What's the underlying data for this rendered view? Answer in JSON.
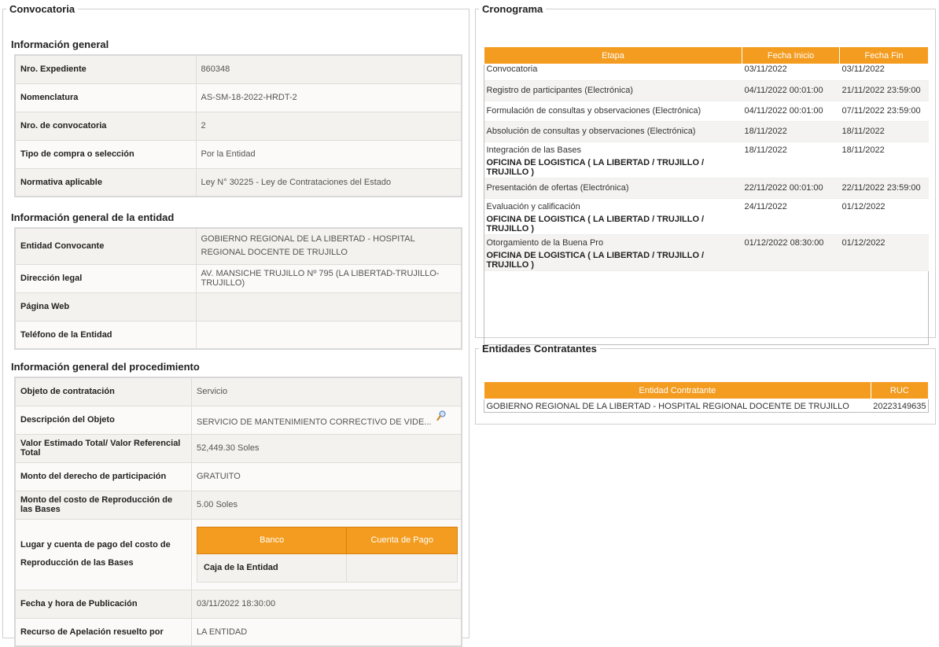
{
  "convocatoria": {
    "legend": "Convocatoria",
    "info_general": {
      "title": "Información general",
      "rows": [
        {
          "label": "Nro. Expediente",
          "value": "860348"
        },
        {
          "label": "Nomenclatura",
          "value": "AS-SM-18-2022-HRDT-2"
        },
        {
          "label": "Nro. de convocatoria",
          "value": "2"
        },
        {
          "label": "Tipo de compra o selección",
          "value": "Por la Entidad"
        },
        {
          "label": "Normativa aplicable",
          "value": "Ley N° 30225 - Ley de Contrataciones del Estado"
        }
      ]
    },
    "info_entidad": {
      "title": "Información general de la entidad",
      "rows": [
        {
          "label": "Entidad Convocante",
          "value": "GOBIERNO REGIONAL DE LA LIBERTAD - HOSPITAL REGIONAL DOCENTE DE TRUJILLO"
        },
        {
          "label": "Dirección legal",
          "value": "AV. MANSICHE TRUJILLO Nº 795 (LA LIBERTAD-TRUJILLO-TRUJILLO)"
        },
        {
          "label": "Página Web",
          "value": ""
        },
        {
          "label": "Teléfono de la Entidad",
          "value": ""
        }
      ]
    },
    "info_procedimiento": {
      "title": "Información general del procedimiento",
      "rows": [
        {
          "label": "Objeto de contratación",
          "value": "Servicio"
        },
        {
          "label": "Descripción del Objeto",
          "value": "SERVICIO DE MANTENIMIENTO CORRECTIVO DE VIDE..."
        },
        {
          "label": "Valor Estimado Total/ Valor Referencial Total",
          "value": "52,449.30 Soles"
        },
        {
          "label": "Monto del derecho de participación",
          "value": "GRATUITO"
        },
        {
          "label": "Monto del costo de Reproducción de las Bases",
          "value": "5.00 Soles"
        },
        {
          "label": "Lugar y cuenta de pago del costo de Reproducción de las Bases",
          "value": ""
        },
        {
          "label": "Fecha y hora de Publicación",
          "value": "03/11/2022 18:30:00"
        },
        {
          "label": "Recurso de Apelación resuelto por",
          "value": "LA ENTIDAD"
        }
      ],
      "pago": {
        "headers": [
          "Banco",
          "Cuenta de Pago"
        ],
        "row": [
          "Caja de la Entidad",
          ""
        ]
      }
    }
  },
  "cronograma": {
    "legend": "Cronograma",
    "headers": [
      "Etapa",
      "Fecha Inicio",
      "Fecha Fin"
    ],
    "rows": [
      {
        "etapa": "Convocatoria",
        "sub": "",
        "inicio": "03/11/2022",
        "fin": "03/11/2022"
      },
      {
        "etapa": "Registro de participantes (Electrónica)",
        "sub": "",
        "inicio": "04/11/2022 00:01:00",
        "fin": "21/11/2022 23:59:00"
      },
      {
        "etapa": "Formulación de consultas y observaciones (Electrónica)",
        "sub": "",
        "inicio": "04/11/2022 00:01:00",
        "fin": "07/11/2022 23:59:00"
      },
      {
        "etapa": "Absolución de consultas y observaciones (Electrónica)",
        "sub": "",
        "inicio": "18/11/2022",
        "fin": "18/11/2022"
      },
      {
        "etapa": "Integración de las Bases",
        "sub": "OFICINA DE LOGISTICA ( LA LIBERTAD / TRUJILLO / TRUJILLO )",
        "inicio": "18/11/2022",
        "fin": "18/11/2022"
      },
      {
        "etapa": "Presentación de ofertas (Electrónica)",
        "sub": "",
        "inicio": "22/11/2022 00:01:00",
        "fin": "22/11/2022 23:59:00"
      },
      {
        "etapa": "Evaluación y calificación",
        "sub": "OFICINA DE LOGISTICA ( LA LIBERTAD / TRUJILLO / TRUJILLO )",
        "inicio": "24/11/2022",
        "fin": "01/12/2022"
      },
      {
        "etapa": "Otorgamiento de la Buena Pro",
        "sub": "OFICINA DE LOGISTICA ( LA LIBERTAD / TRUJILLO / TRUJILLO )",
        "inicio": "01/12/2022 08:30:00",
        "fin": "01/12/2022"
      }
    ]
  },
  "entidades": {
    "legend": "Entidades Contratantes",
    "headers": [
      "Entidad Contratante",
      "RUC"
    ],
    "rows": [
      {
        "entidad": "GOBIERNO REGIONAL DE LA LIBERTAD - HOSPITAL REGIONAL DOCENTE DE TRUJILLO",
        "ruc": "20223149635"
      }
    ]
  },
  "colors": {
    "accent": "#f39c1f",
    "zebra": "#f4f2ee"
  },
  "icons": {
    "descripcion_detalle": "magnifier-icon"
  }
}
